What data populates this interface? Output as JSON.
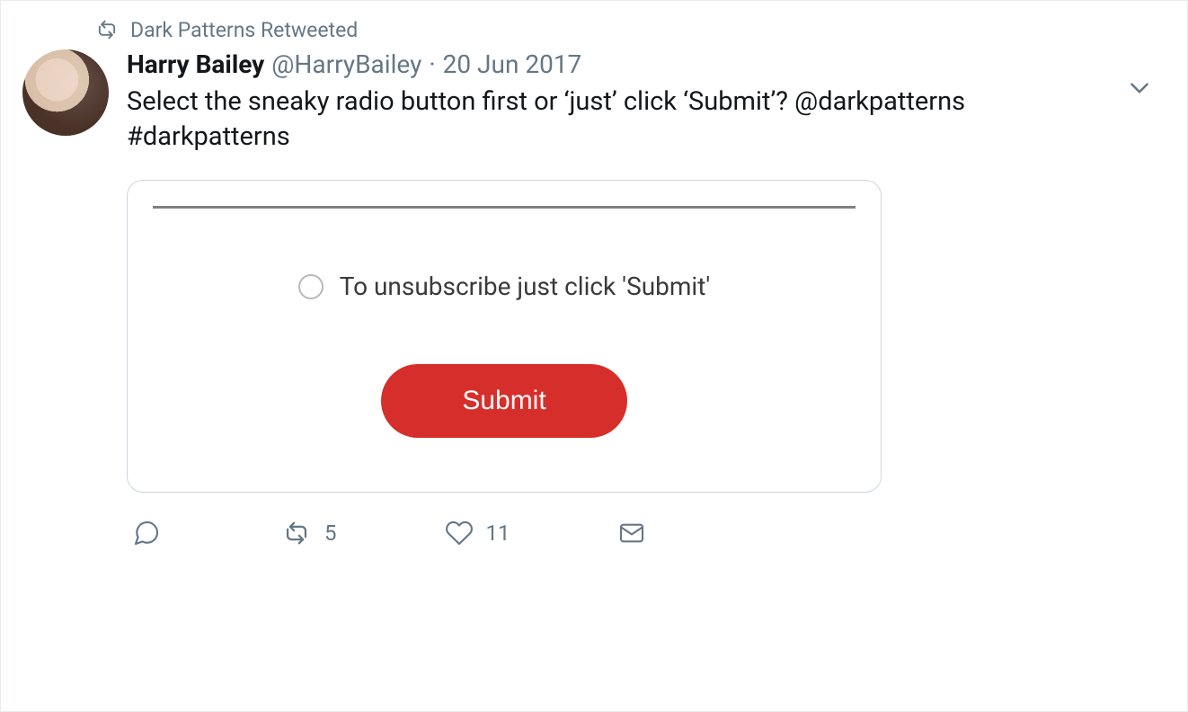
{
  "retweet": {
    "label": "Dark Patterns Retweeted"
  },
  "header": {
    "display_name": "Harry Bailey",
    "handle": "@HarryBailey",
    "separator": "·",
    "timestamp": "20 Jun 2017"
  },
  "tweet": {
    "text": "Select the sneaky radio button first or ‘just’ click ‘Submit’? @darkpatterns #darkpatterns"
  },
  "embedded": {
    "radio_label": "To unsubscribe just click 'Submit'",
    "submit_label": "Submit"
  },
  "actions": {
    "reply_count": "",
    "retweet_count": "5",
    "like_count": "11"
  }
}
